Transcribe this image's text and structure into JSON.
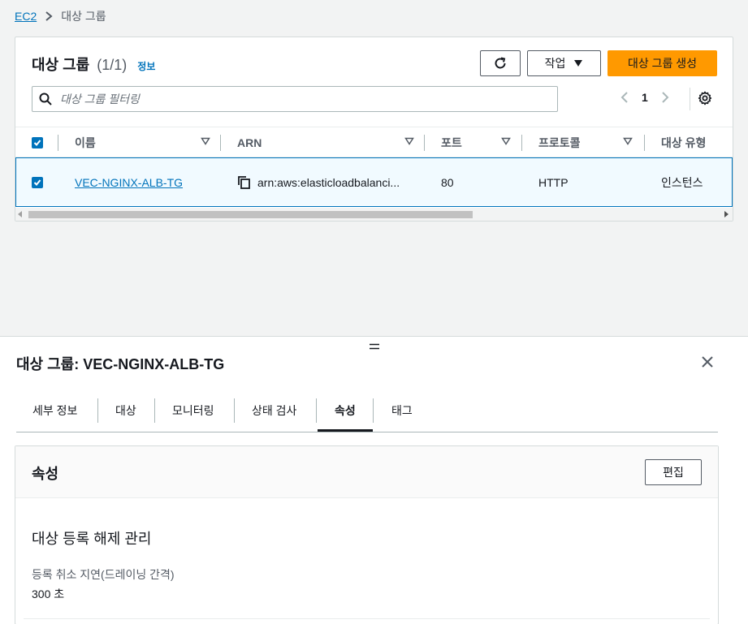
{
  "breadcrumb": {
    "root": "EC2",
    "current": "대상 그룹"
  },
  "list": {
    "title": "대상 그룹",
    "count": "(1/1)",
    "info": "정보",
    "actions_label": "작업",
    "create_label": "대상 그룹 생성",
    "filter_placeholder": "대상 그룹 필터링",
    "page": "1",
    "columns": [
      "이름",
      "ARN",
      "포트",
      "프로토콜",
      "대상 유형"
    ],
    "rows": [
      {
        "name": "VEC-NGINX-ALB-TG",
        "arn": "arn:aws:elasticloadbalanci...",
        "port": "80",
        "protocol": "HTTP",
        "target_type": "인스턴스"
      }
    ]
  },
  "detail": {
    "title": "대상 그룹: VEC-NGINX-ALB-TG",
    "tabs": [
      "세부 정보",
      "대상",
      "모니터링",
      "상태 검사",
      "속성",
      "태그"
    ],
    "active_tab": "속성",
    "section_title": "속성",
    "edit_label": "편집",
    "subsection": "대상 등록 해제 관리",
    "field_label": "등록 취소 지연(드레이닝 간격)",
    "field_value": "300 초"
  },
  "colors": {
    "link": "#0073bb",
    "primary": "#ff9900",
    "selected_row": "#f1faff"
  }
}
